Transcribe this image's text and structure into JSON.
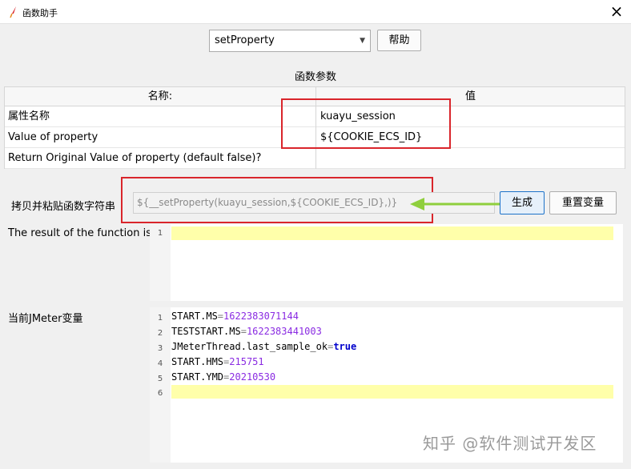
{
  "window": {
    "title": "函数助手",
    "close_symbol": "×"
  },
  "toolbar": {
    "selected_function": "setProperty",
    "help_label": "帮助"
  },
  "params": {
    "section_title": "函数参数",
    "columns": [
      "名称:",
      "值"
    ],
    "rows": [
      {
        "name": "属性名称",
        "value": "kuayu_session"
      },
      {
        "name": "Value of property",
        "value": "${COOKIE_ECS_ID}"
      },
      {
        "name": "Return Original Value of property (default false)?",
        "value": ""
      }
    ]
  },
  "copy": {
    "label": "拷贝并粘贴函数字符串",
    "function_string": "${__setProperty(kuayu_session,${COOKIE_ECS_ID},)}",
    "generate_label": "生成",
    "reset_label": "重置变量"
  },
  "result": {
    "label": "The result of the function is",
    "line_numbers": [
      "1"
    ]
  },
  "jmeter_vars": {
    "label": "当前JMeter变量",
    "lines": [
      {
        "n": "1",
        "key": "START.MS",
        "val": "1622383071144",
        "kind": "num"
      },
      {
        "n": "2",
        "key": "TESTSTART.MS",
        "val": "1622383441003",
        "kind": "num"
      },
      {
        "n": "3",
        "key": "JMeterThread.last_sample_ok",
        "val": "true",
        "kind": "bool"
      },
      {
        "n": "4",
        "key": "START.HMS",
        "val": "215751",
        "kind": "num"
      },
      {
        "n": "5",
        "key": "START.YMD",
        "val": "20210530",
        "kind": "num"
      },
      {
        "n": "6",
        "key": "",
        "val": "",
        "kind": "empty"
      }
    ]
  },
  "watermark": "知乎 @软件测试开发区",
  "colors": {
    "highlight_box": "#d9252b",
    "annotation_arrow": "#8fcf3d",
    "current_line": "#ffffaa"
  }
}
